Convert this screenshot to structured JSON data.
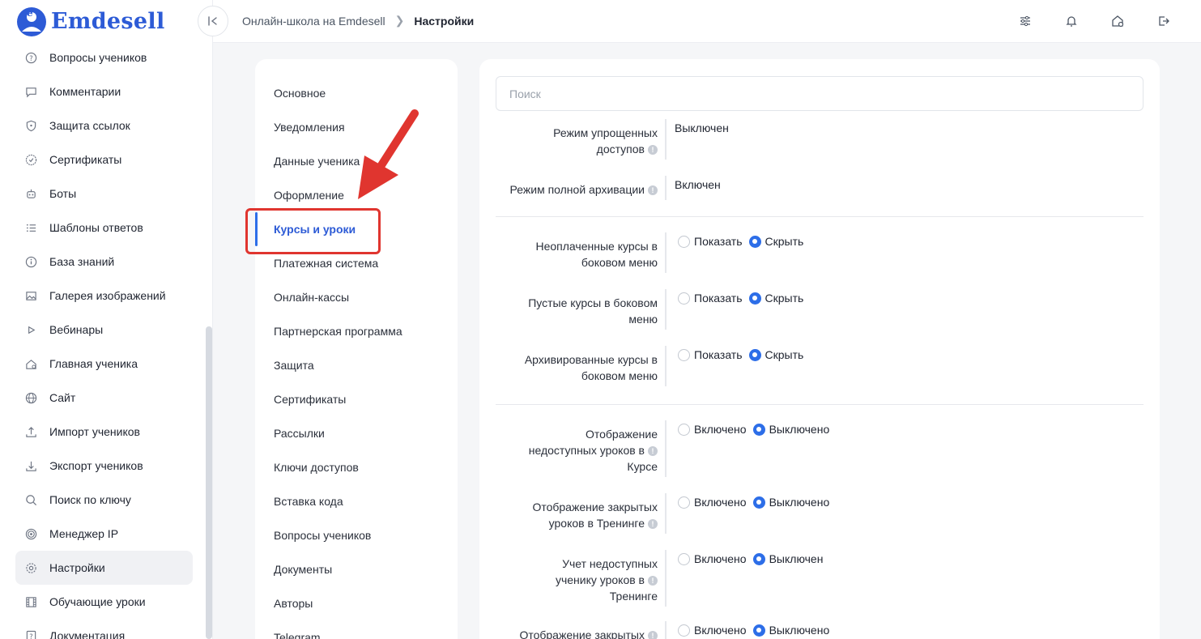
{
  "brand": {
    "name": "Emdesell",
    "color": "#2d5bd6"
  },
  "sidebar": {
    "items": [
      {
        "label": "Вопросы учеников",
        "icon": "question-circle-icon"
      },
      {
        "label": "Комментарии",
        "icon": "comment-icon"
      },
      {
        "label": "Защита ссылок",
        "icon": "shield-icon"
      },
      {
        "label": "Сертификаты",
        "icon": "certificate-icon"
      },
      {
        "label": "Боты",
        "icon": "robot-icon"
      },
      {
        "label": "Шаблоны ответов",
        "icon": "list-icon"
      },
      {
        "label": "База знаний",
        "icon": "info-circle-icon"
      },
      {
        "label": "Галерея изображений",
        "icon": "image-icon"
      },
      {
        "label": "Вебинары",
        "icon": "play-icon"
      },
      {
        "label": "Главная ученика",
        "icon": "home-icon"
      },
      {
        "label": "Сайт",
        "icon": "globe-icon"
      },
      {
        "label": "Импорт учеников",
        "icon": "upload-icon"
      },
      {
        "label": "Экспорт учеников",
        "icon": "download-icon"
      },
      {
        "label": "Поиск по ключу",
        "icon": "search-icon"
      },
      {
        "label": "Менеджер IP",
        "icon": "target-icon"
      },
      {
        "label": "Настройки",
        "icon": "gear-icon",
        "active": true
      },
      {
        "label": "Обучающие уроки",
        "icon": "film-icon"
      },
      {
        "label": "Документация",
        "icon": "help-doc-icon"
      }
    ]
  },
  "topbar": {
    "breadcrumb": {
      "parent": "Онлайн-школа на Emdesell",
      "current": "Настройки"
    },
    "icons": [
      "sliders-icon",
      "bell-icon",
      "home-settings-icon",
      "logout-icon"
    ]
  },
  "settings_menu": {
    "items": [
      "Основное",
      "Уведомления",
      "Данные ученика",
      "Оформление",
      "Курсы и уроки",
      "Платежная система",
      "Онлайн-кассы",
      "Партнерская программа",
      "Защита",
      "Сертификаты",
      "Рассылки",
      "Ключи доступов",
      "Вставка кода",
      "Вопросы учеников",
      "Документы",
      "Авторы",
      "Telegram"
    ],
    "active_index": 4
  },
  "content": {
    "search_placeholder": "Поиск",
    "options": {
      "show": "Показать",
      "hide": "Скрыть",
      "on": "Включено",
      "off": "Выключено",
      "off_short": "Выключен"
    },
    "rows": [
      {
        "label_lines": [
          "Режим упрощенных",
          "доступов"
        ],
        "info": true,
        "value": "Выключен"
      },
      {
        "label_lines": [
          "Режим полной архивации"
        ],
        "info": true,
        "value": "Включен"
      },
      {
        "label_lines": [
          "Неоплаченные курсы в",
          "боковом меню"
        ],
        "selected": "Скрыть"
      },
      {
        "label_lines": [
          "Пустые курсы в боковом",
          "меню"
        ],
        "selected": "Скрыть"
      },
      {
        "label_lines": [
          "Архивированные курсы в",
          "боковом меню"
        ],
        "selected": "Скрыть"
      },
      {
        "label_lines": [
          "Отображение",
          "недоступных уроков в",
          "Курсе"
        ],
        "info": true,
        "selected": "Выключено"
      },
      {
        "label_lines": [
          "Отображение закрытых",
          "уроков в Тренинге"
        ],
        "info": true,
        "selected": "Выключено"
      },
      {
        "label_lines": [
          "Учет недоступных",
          "ученику уроков в",
          "Тренинге"
        ],
        "info": true,
        "selected": "Выключен"
      },
      {
        "label_lines": [
          "Отображение закрытых"
        ],
        "info": true,
        "selected": "Выключено"
      }
    ]
  },
  "colors": {
    "accent": "#2d6ee8",
    "annotation": "#e0352f"
  }
}
